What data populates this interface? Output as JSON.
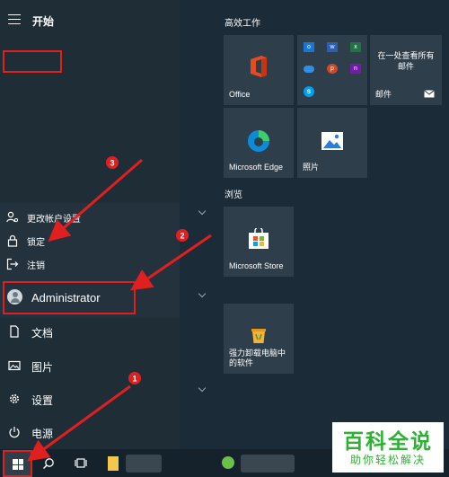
{
  "start": {
    "title": "开始"
  },
  "account_menu": {
    "change_account_settings": "更改帐户设置",
    "lock": "锁定",
    "sign_out": "注销"
  },
  "user": {
    "name": "Administrator"
  },
  "nav": {
    "documents": "文档",
    "pictures": "图片",
    "settings": "设置",
    "power": "电源"
  },
  "groups": {
    "productivity": "高效工作",
    "browse": "浏览"
  },
  "tiles": {
    "office": "Office",
    "mail_promo": "在一处查看所有邮件",
    "mail": "邮件",
    "edge": "Microsoft Edge",
    "photos": "照片",
    "store": "Microsoft Store",
    "uninstaller": "强力卸载电脑中的软件"
  },
  "annotations": {
    "step1": "1",
    "step2": "2",
    "step3": "3"
  },
  "watermark": {
    "title": "百科全说",
    "subtitle": "助你轻松解决"
  },
  "colors": {
    "annotation": "#e02020",
    "tile": "#2e3e4b",
    "background": "#1b2b38",
    "watermark": "#2db134"
  },
  "icons": [
    "hamburger-icon",
    "person-settings-icon",
    "lock-icon",
    "sign-out-icon",
    "avatar-icon",
    "document-icon",
    "pictures-icon",
    "gear-icon",
    "power-icon",
    "windows-logo-icon",
    "search-icon",
    "task-view-icon",
    "file-explorer-icon"
  ]
}
